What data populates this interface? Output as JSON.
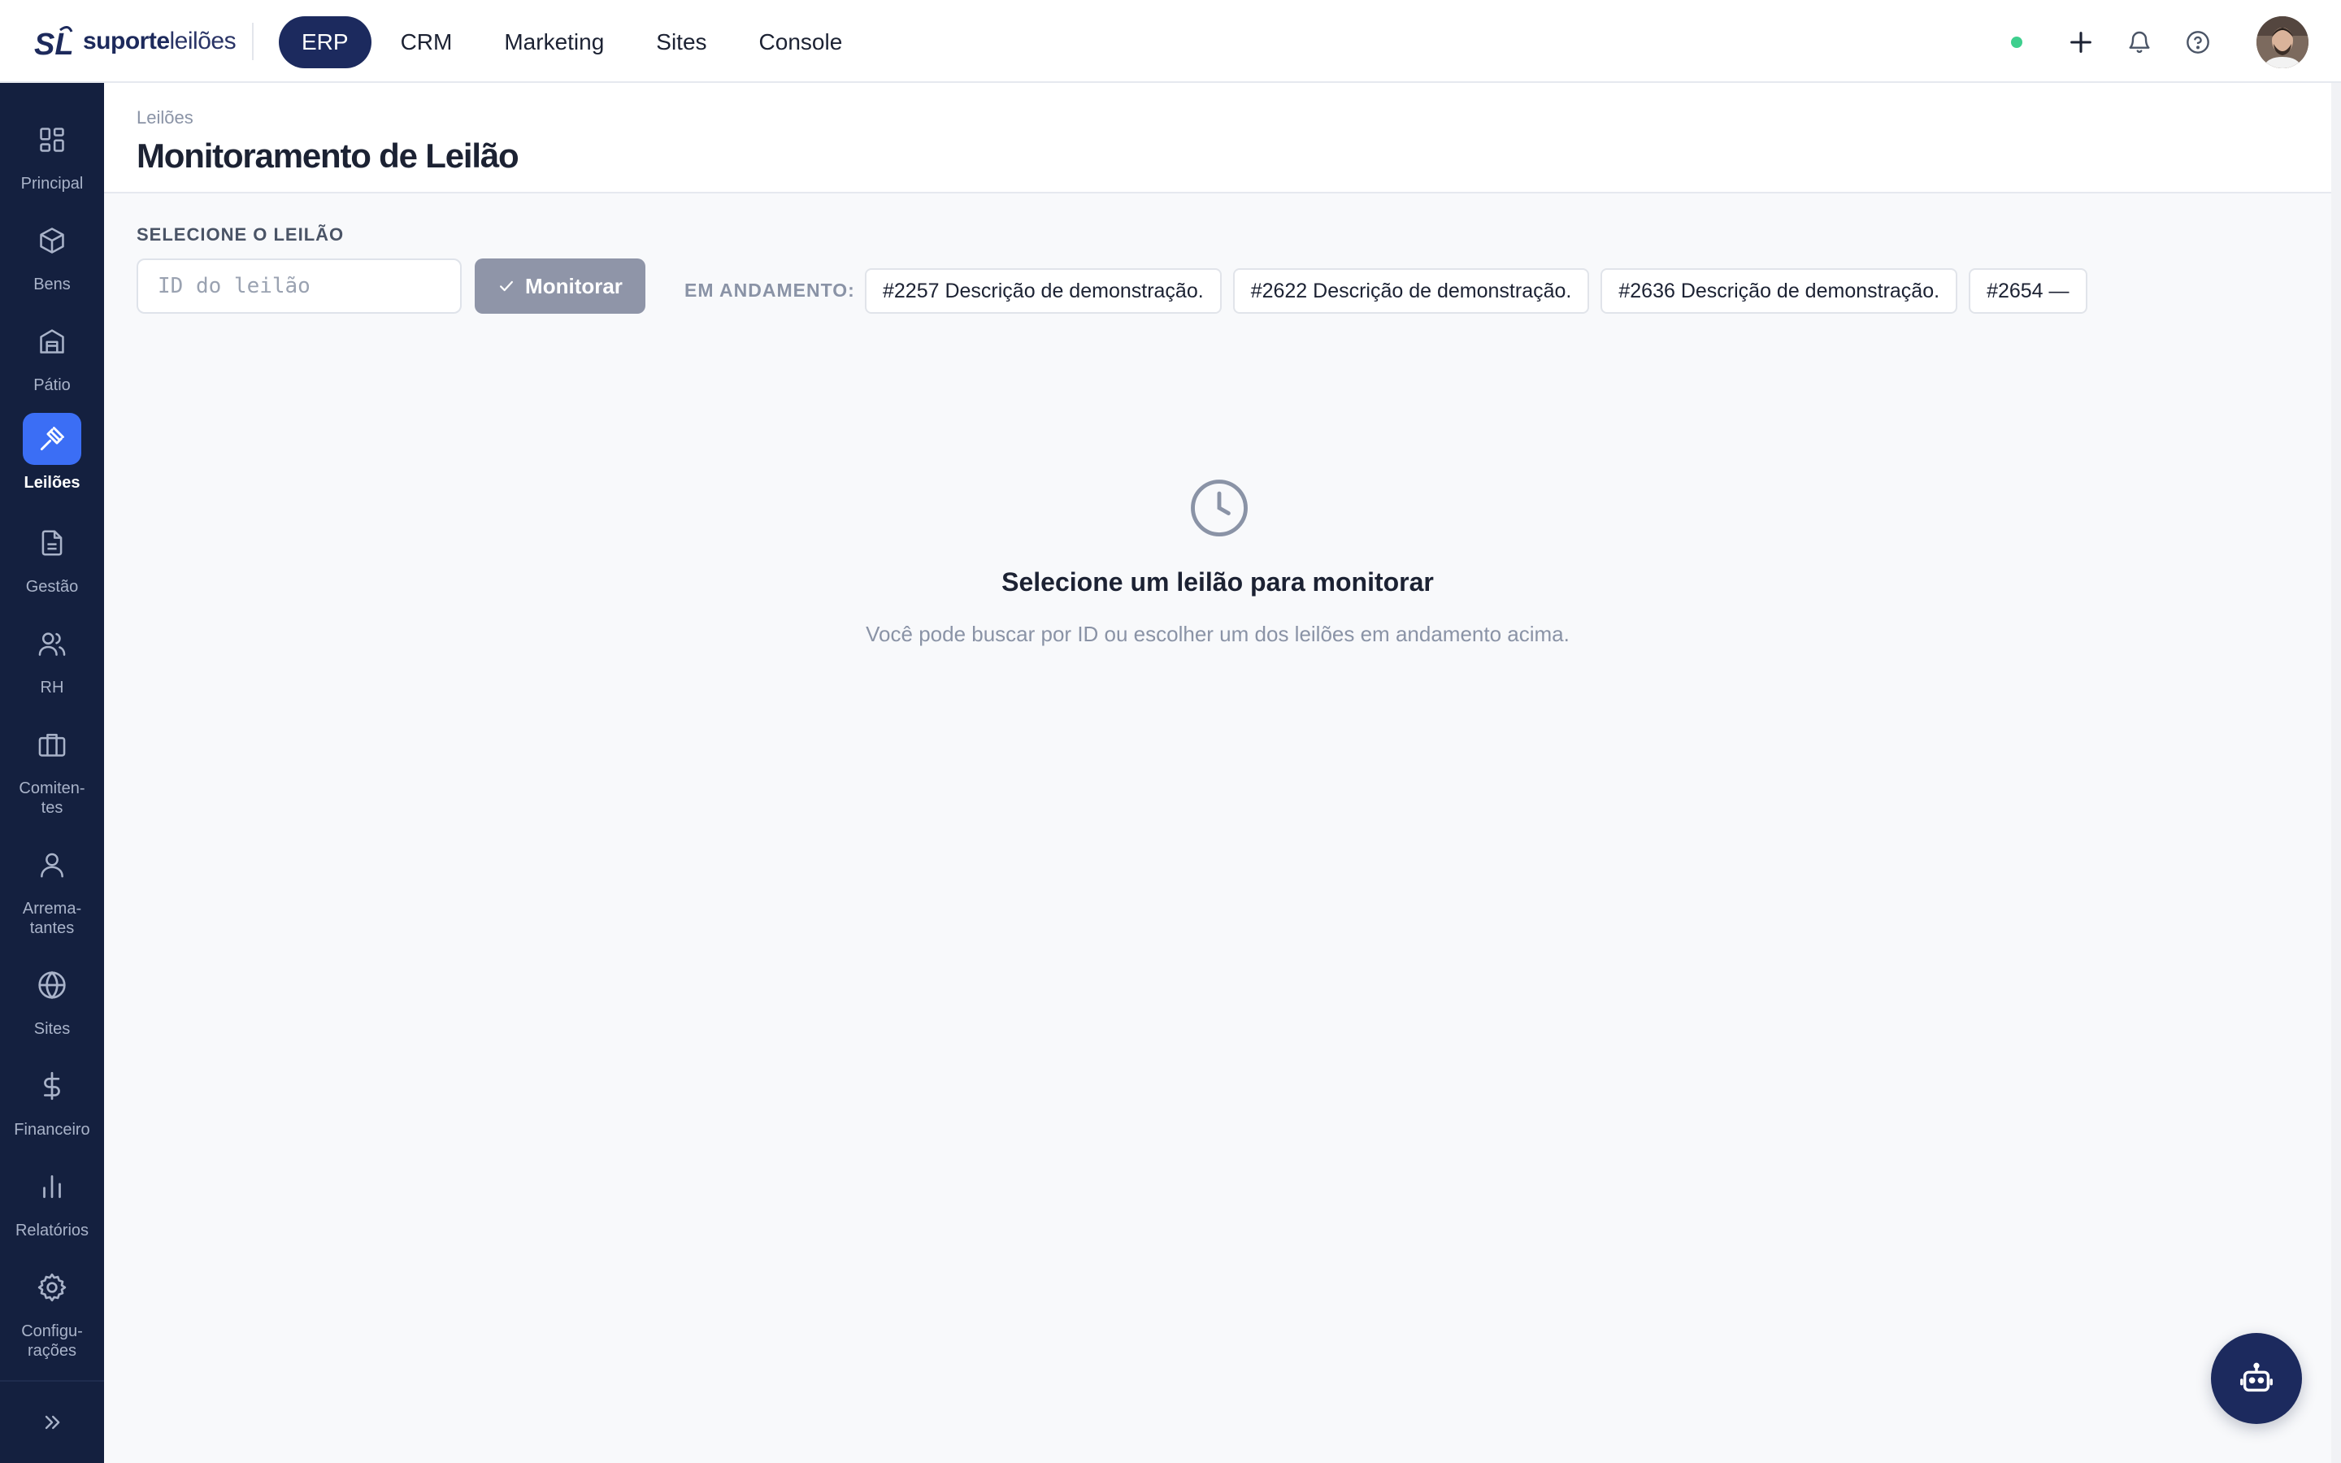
{
  "brand": {
    "mark": "SL",
    "name_bold": "suporte",
    "name_light": "leilões"
  },
  "topnav": {
    "tabs": [
      {
        "label": "ERP",
        "active": true
      },
      {
        "label": "CRM",
        "active": false
      },
      {
        "label": "Marketing",
        "active": false
      },
      {
        "label": "Sites",
        "active": false
      },
      {
        "label": "Console",
        "active": false
      }
    ],
    "status": "online",
    "icons": [
      "plus-icon",
      "bell-icon",
      "help-icon"
    ]
  },
  "sidebar": {
    "items": [
      {
        "label": "Principal",
        "icon": "dashboard-icon"
      },
      {
        "label": "Bens",
        "icon": "box-icon"
      },
      {
        "label": "Pátio",
        "icon": "warehouse-icon"
      },
      {
        "label": "Leilões",
        "icon": "gavel-icon",
        "active": true
      },
      {
        "label": "Gestão",
        "icon": "document-icon"
      },
      {
        "label": "RH",
        "icon": "users-icon"
      },
      {
        "label": "Comiten-\ntes",
        "icon": "briefcase-icon"
      },
      {
        "label": "Arrema-\ntantes",
        "icon": "user-icon"
      },
      {
        "label": "Sites",
        "icon": "globe-icon"
      },
      {
        "label": "Financeiro",
        "icon": "dollar-icon"
      },
      {
        "label": "Relatórios",
        "icon": "bar-chart-icon"
      },
      {
        "label": "Configu-\nrações",
        "icon": "gear-icon"
      }
    ],
    "collapse_icon": "chevrons-right-icon"
  },
  "header": {
    "breadcrumb": "Leilões",
    "title": "Monitoramento de Leilão"
  },
  "selector": {
    "label": "SELECIONE O LEILÃO",
    "input_placeholder": "ID do leilão",
    "input_value": "",
    "button_label": "Monitorar",
    "running_label": "EM ANDAMENTO:",
    "running": [
      "#2257 Descrição de demonstração.",
      "#2622 Descrição de demonstração.",
      "#2636 Descrição de demonstração.",
      "#2654 —"
    ]
  },
  "empty_state": {
    "icon": "clock-icon",
    "title": "Selecione um leilão para monitorar",
    "subtitle": "Você pode buscar por ID ou escolher um dos leilões em andamento acima."
  },
  "assistant": {
    "icon": "robot-icon"
  },
  "colors": {
    "navy": "#1c2a5e",
    "sidebar": "#14203f",
    "accent": "#3b6ef5",
    "status": "#3ecf8e"
  }
}
